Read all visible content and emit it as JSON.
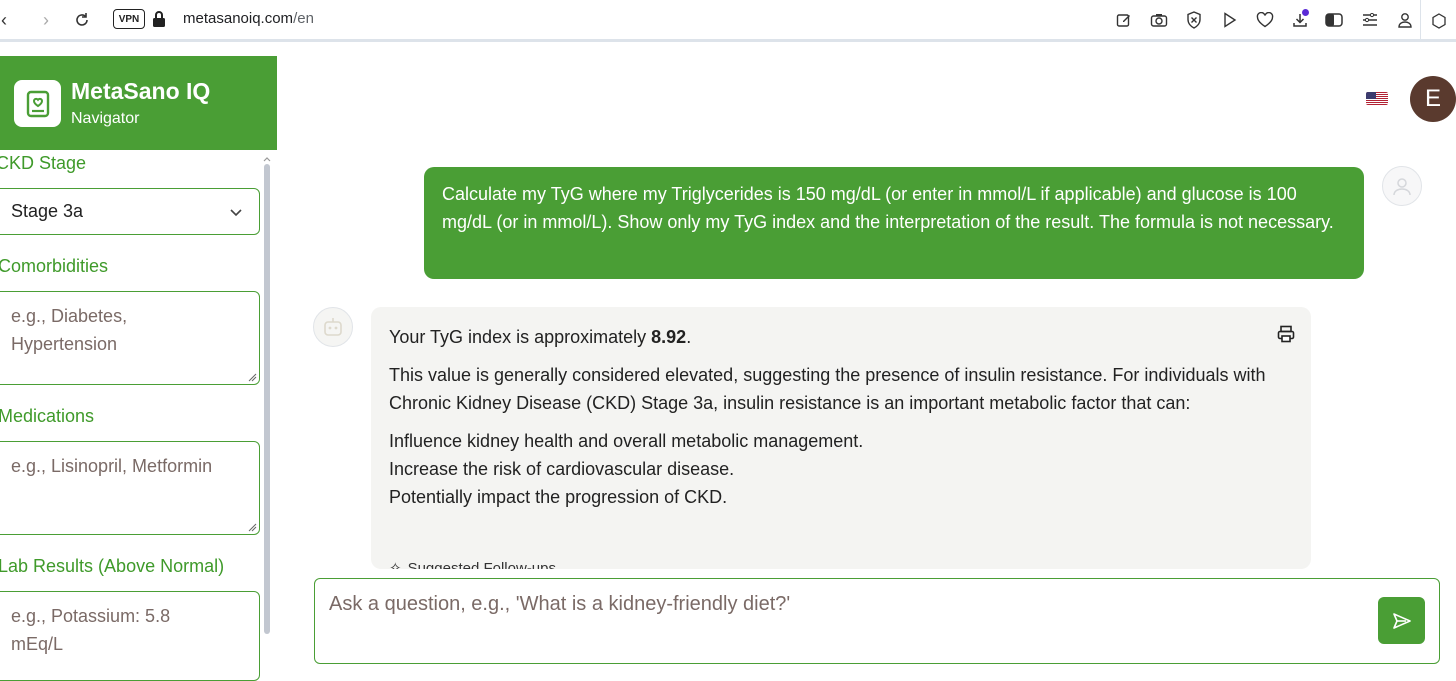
{
  "browser": {
    "vpn_label": "VPN",
    "url_domain": "metasanoiq.com",
    "url_path": "/en"
  },
  "sidebar": {
    "app_title": "MetaSano IQ",
    "app_subtitle": "Navigator",
    "ckd_label": "CKD Stage",
    "ckd_value": "Stage 3a",
    "comorbidities_label": "Comorbidities",
    "comorbidities_placeholder": "e.g., Diabetes, Hypertension",
    "medications_label": "Medications",
    "medications_placeholder": "e.g., Lisinopril, Metformin",
    "lab_label": "Lab Results (Above Normal)",
    "lab_placeholder": "e.g., Potassium: 5.8 mEq/L"
  },
  "header": {
    "avatar_initial": "E"
  },
  "chat": {
    "user_message": "Calculate my TyG where my Triglycerides is 150 mg/dL (or enter in mmol/L if applicable) and glucose is 100 mg/dL (or in mmol/L). Show only my TyG index and the interpretation of the result. The formula is not necessary.",
    "bot_intro": "Your TyG index is approximately ",
    "bot_value": "8.92",
    "bot_intro_end": ".",
    "bot_paragraph": "This value is generally considered elevated, suggesting the presence of insulin resistance. For individuals with Chronic Kidney Disease (CKD) Stage 3a, insulin resistance is an important metabolic factor that can:",
    "bot_points": [
      "Influence kidney health and overall metabolic management.",
      "Increase the risk of cardiovascular disease.",
      "Potentially impact the progression of CKD."
    ],
    "followups_label": "Suggested Follow-ups"
  },
  "input": {
    "placeholder": "Ask a question, e.g., 'What is a kidney-friendly diet?'"
  },
  "colors": {
    "brand_green": "#4a9e35",
    "label_green": "#3f9a2a",
    "bot_bubble": "#f4f4f2",
    "avatar_brown": "#5a3a2e"
  },
  "icons": [
    "back-icon",
    "forward-icon",
    "reload-icon",
    "lock-icon",
    "edit-icon",
    "camera-icon",
    "shield-icon",
    "play-icon",
    "heart-icon",
    "download-icon",
    "sidebar-toggle-icon",
    "menu-icon",
    "profile-icon",
    "book-icon",
    "chevron-down-icon",
    "flag-us-icon",
    "user-icon",
    "bot-icon",
    "print-icon",
    "sparkle-icon",
    "send-icon"
  ]
}
